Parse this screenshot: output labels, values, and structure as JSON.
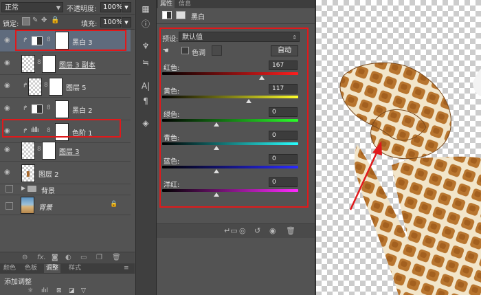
{
  "layers_panel": {
    "blend_mode": "正常",
    "opacity_label": "不透明度:",
    "opacity_value": "100%",
    "lock_label": "锁定:",
    "fill_label": "填充:",
    "fill_value": "100%",
    "layers": [
      {
        "name": "黑白 3",
        "type": "adjustment",
        "active": true
      },
      {
        "name": "图层 3 副本",
        "type": "pixel"
      },
      {
        "name": "图层 5",
        "type": "pixel"
      },
      {
        "name": "黑白 2",
        "type": "adjustment"
      },
      {
        "name": "色阶 1",
        "type": "adjustment"
      },
      {
        "name": "图层 3",
        "type": "pixel"
      },
      {
        "name": "图层 2",
        "type": "pixel"
      },
      {
        "name": "背景",
        "type": "group"
      },
      {
        "name": "背景",
        "type": "background"
      }
    ],
    "bottom_tabs": [
      "颜色",
      "色板",
      "调整",
      "样式"
    ],
    "active_bottom_tab": "调整",
    "adjust_title": "添加调整"
  },
  "properties_panel": {
    "tabs": [
      "属性",
      "信息"
    ],
    "active_tab": "属性",
    "title": "黑白",
    "preset_label": "预设:",
    "preset_value": "默认值",
    "tint_label": "色调",
    "auto_button": "自动",
    "sliders": [
      {
        "label": "红色:",
        "value": 167,
        "color": "red"
      },
      {
        "label": "黄色:",
        "value": 117,
        "color": "yellow"
      },
      {
        "label": "绿色:",
        "value": 0,
        "color": "green"
      },
      {
        "label": "青色:",
        "value": 0,
        "color": "cyan"
      },
      {
        "label": "蓝色:",
        "value": 0,
        "color": "blue"
      },
      {
        "label": "洋红:",
        "value": 0,
        "color": "magenta"
      }
    ]
  },
  "colors": {
    "highlight_box": "#e0191b",
    "active_layer": "#5f6b7d",
    "panel_bg": "#535353"
  }
}
